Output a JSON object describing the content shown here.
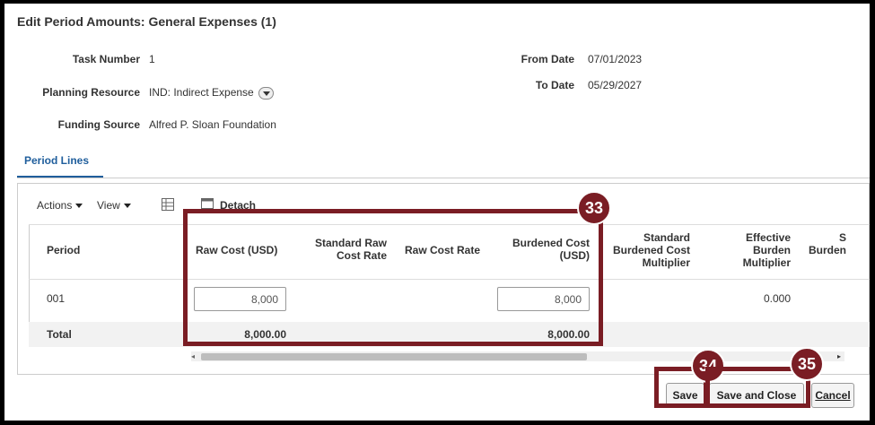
{
  "dialog": {
    "title": "Edit Period Amounts: General Expenses (1)"
  },
  "form": {
    "task_number_label": "Task Number",
    "task_number_value": "1",
    "planning_resource_label": "Planning Resource",
    "planning_resource_value": "IND: Indirect Expense",
    "funding_source_label": "Funding Source",
    "funding_source_value": "Alfred P. Sloan Foundation",
    "from_date_label": "From Date",
    "from_date_value": "07/01/2023",
    "to_date_label": "To Date",
    "to_date_value": "05/29/2027"
  },
  "tabs": {
    "period_lines": "Period Lines"
  },
  "toolbar": {
    "actions": "Actions",
    "view": "View",
    "detach": "Detach"
  },
  "table": {
    "headers": {
      "period": "Period",
      "raw_cost": "Raw Cost (USD)",
      "std_raw_cost_rate": "Standard Raw Cost Rate",
      "raw_cost_rate": "Raw Cost Rate",
      "burdened_cost": "Burdened Cost (USD)",
      "std_burdened_cost_multiplier": "Standard Burdened Cost Multiplier",
      "effective_burden_multiplier": "Effective Burden Multiplier",
      "partial_s": "S",
      "partial_burden": "Burden"
    },
    "row": {
      "period": "001",
      "raw_cost": "8,000",
      "burdened_cost": "8,000",
      "effective_burden_multiplier": "0.000"
    },
    "total": {
      "label": "Total",
      "raw_cost": "8,000.00",
      "burdened_cost": "8,000.00"
    }
  },
  "callouts": {
    "c33": "33",
    "c34": "34",
    "c35": "35"
  },
  "buttons": {
    "save": "Save",
    "save_and_close": "Save and Close",
    "cancel": "Cancel"
  },
  "colors": {
    "callout": "#7a1d24",
    "tab_accent": "#1f5e9c"
  }
}
